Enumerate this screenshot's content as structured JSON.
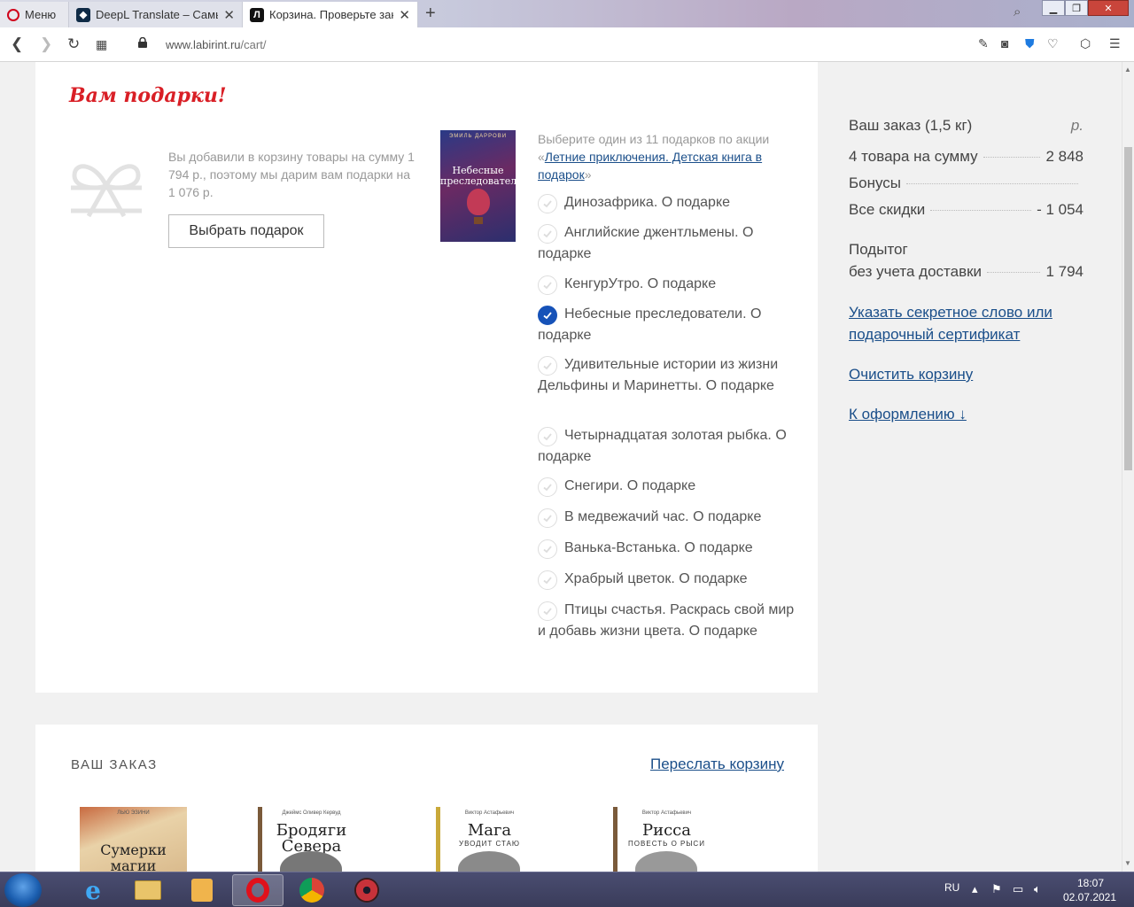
{
  "browser": {
    "tabs": [
      {
        "label": "Меню",
        "favicon": "O",
        "favicon_color": "#d0021b"
      },
      {
        "label": "DeepL Translate – Самый т",
        "favicon": "◆",
        "favicon_color": "#0f2b46"
      },
      {
        "label": "Корзина. Проверьте заказ",
        "favicon": "Л",
        "favicon_color": "#111111"
      }
    ],
    "url": "www.labirint.ru/cart/",
    "url_host": "www.labirint.ru",
    "url_path": "/cart/"
  },
  "gifts": {
    "title": "Вам подарки!",
    "description": "Вы добавили в корзину товары на сумму 1 794 р., поэтому мы дарим вам подарки на 1 076 р.",
    "choose_button": "Выбрать подарок",
    "cover_author": "ЭМИЛЬ ДАРРОВИ",
    "cover_title": "Небесные преследователи",
    "offer_prefix": "Выберите один из 11 подарков по акции «",
    "offer_link": "Летние приключения. Детская книга в подарок",
    "offer_suffix": "»",
    "items": [
      {
        "label": "Динозафрика. О подарке",
        "selected": false
      },
      {
        "label": "Английские джентльмены. О подарке",
        "selected": false
      },
      {
        "label": "КенгурУтро. О подарке",
        "selected": false
      },
      {
        "label": "Небесные преследователи. О подарке",
        "selected": true
      },
      {
        "label": "Удивительные истории из жизни Дельфины и Маринетты. О подарке",
        "selected": false
      },
      {
        "label": "Четырнадцатая золотая рыбка. О подарке",
        "selected": false
      },
      {
        "label": "Снегири. О подарке",
        "selected": false
      },
      {
        "label": "В медвежачий час. О подарке",
        "selected": false
      },
      {
        "label": "Ванька-Встанька. О подарке",
        "selected": false
      },
      {
        "label": "Храбрый цветок. О подарке",
        "selected": false
      },
      {
        "label": "Птицы счастья. Раскрась свой мир и добавь жизни цвета. О подарке",
        "selected": false
      }
    ]
  },
  "summary": {
    "order_label": "Ваш заказ (1,5 кг)",
    "currency": "р.",
    "items_label": "4 товара на сумму",
    "items_value": "2 848",
    "bonus_label": "Бонусы",
    "discount_label": "Все скидки",
    "discount_value": "- 1 054",
    "subtotal_label_1": "Подытог",
    "subtotal_label_2": "без учета доставки",
    "subtotal_value": "1 794",
    "secret_link_1": "Указать секретное слово или",
    "secret_link_2": "подарочный сертификат",
    "clear_link": "Очистить корзину",
    "checkout_link": "К оформлению ↓"
  },
  "order": {
    "title": "ВАШ ЗАКАЗ",
    "send_link": "Переслать корзину",
    "books": [
      {
        "author": "ЛЬЮ ЭЗИНИ",
        "title": "Сумерки магии",
        "subtitle": "",
        "accent": "#c45a3a"
      },
      {
        "author": "Джеймс Оливер Кервуд",
        "title": "Бродяги Севера",
        "subtitle": "",
        "accent": "#7a5a3a"
      },
      {
        "author": "Виктор Астафьевич",
        "title": "Мага",
        "subtitle": "УВОДИТ СТАЮ",
        "accent": "#c9a93a"
      },
      {
        "author": "Виктор Астафьевич",
        "title": "Рисса",
        "subtitle": "ПОВЕСТЬ О РЫСИ",
        "accent": "#7a5a3a"
      }
    ]
  },
  "taskbar": {
    "language": "RU",
    "time": "18:07",
    "date": "02.07.2021"
  }
}
